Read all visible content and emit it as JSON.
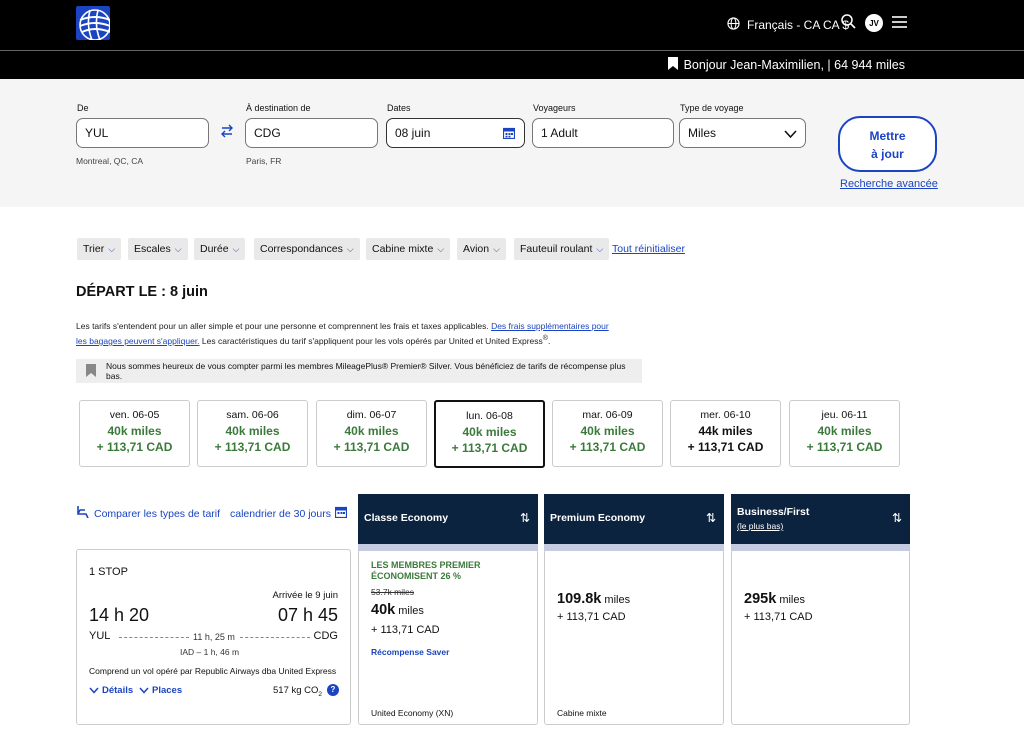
{
  "header": {
    "language": "Français - CA CA $",
    "avatar_initials": "JV",
    "greeting": "Bonjour Jean-Maximilien, | 64 944 miles"
  },
  "search": {
    "from_label": "De",
    "from_value": "YUL",
    "from_sub": "Montreal, QC, CA",
    "to_label": "À destination de",
    "to_value": "CDG",
    "to_sub": "Paris, FR",
    "dates_label": "Dates",
    "dates_value": "08 juin",
    "travelers_label": "Voyageurs",
    "travelers_value": "1 Adult",
    "trip_label": "Type de voyage",
    "trip_value": "Miles",
    "update_line1": "Mettre",
    "update_line2": "à jour",
    "advanced": "Recherche avancée"
  },
  "filters": {
    "items": [
      "Trier",
      "Escales",
      "Durée",
      "Correspondances",
      "Cabine mixte",
      "Avion",
      "Fauteuil roulant"
    ],
    "reset": "Tout réinitialiser"
  },
  "page_title": "DÉPART LE : 8 juin",
  "notice": {
    "text1": "Les tarifs s'entendent pour un aller simple et pour une personne et comprennent les frais et taxes applicables. ",
    "link": "Des frais supplémentaires pour les bagages peuvent s'appliquer.",
    "text2": " Les caractéristiques du tarif s'appliquent pour les vols opérés par United et United Express",
    "sup": "®",
    "end": "."
  },
  "banner": "Nous sommes heureux de vous compter parmi les membres MileagePlus® Premier® Silver. Vous bénéficiez de tarifs de récompense plus bas.",
  "dates": [
    {
      "day": "ven. 06-05",
      "miles": "40k miles",
      "price": "+ 113,71 CAD"
    },
    {
      "day": "sam. 06-06",
      "miles": "40k miles",
      "price": "+ 113,71 CAD"
    },
    {
      "day": "dim. 06-07",
      "miles": "40k miles",
      "price": "+ 113,71 CAD"
    },
    {
      "day": "lun. 06-08",
      "miles": "40k miles",
      "price": "+ 113,71 CAD"
    },
    {
      "day": "mar. 06-09",
      "miles": "40k miles",
      "price": "+ 113,71 CAD"
    },
    {
      "day": "mer. 06-10",
      "miles": "44k miles",
      "price": "+ 113,71 CAD"
    },
    {
      "day": "jeu. 06-11",
      "miles": "40k miles",
      "price": "+ 113,71 CAD"
    }
  ],
  "compare_label": "Comparer les types de tarif",
  "calendar_label": "calendrier de 30 jours",
  "columns": {
    "economy": "Classe Economy",
    "premium": "Premium Economy",
    "business": "Business/First",
    "business_sub": "(le plus bas)"
  },
  "flight": {
    "stops": "1 STOP",
    "arrival_note": "Arrivée le 9 juin",
    "depart_time": "14 h 20",
    "arrive_time": "07 h 45",
    "origin": "YUL",
    "destination": "CDG",
    "duration": "11 h, 25 m",
    "layover": "IAD – 1 h, 46 m",
    "operated": "Comprend un vol opéré par Republic Airways dba United Express",
    "details": "Détails",
    "seats": "Places",
    "co2": "517 kg CO",
    "co2_sub": "2"
  },
  "fares": {
    "economy": {
      "promo": "LES MEMBRES PREMIER ÉCONOMISENT 26 %",
      "old": "53.7k miles",
      "miles_big": "40k",
      "miles_unit": " miles",
      "price": "+ 113,71 CAD",
      "type": "Récompense Saver",
      "footer": "United Economy (XN)"
    },
    "premium": {
      "miles_big": "109.8k",
      "miles_unit": " miles",
      "price": "+ 113,71 CAD",
      "footer": "Cabine mixte"
    },
    "business": {
      "miles_big": "295k",
      "miles_unit": " miles",
      "price": "+ 113,71 CAD"
    }
  }
}
